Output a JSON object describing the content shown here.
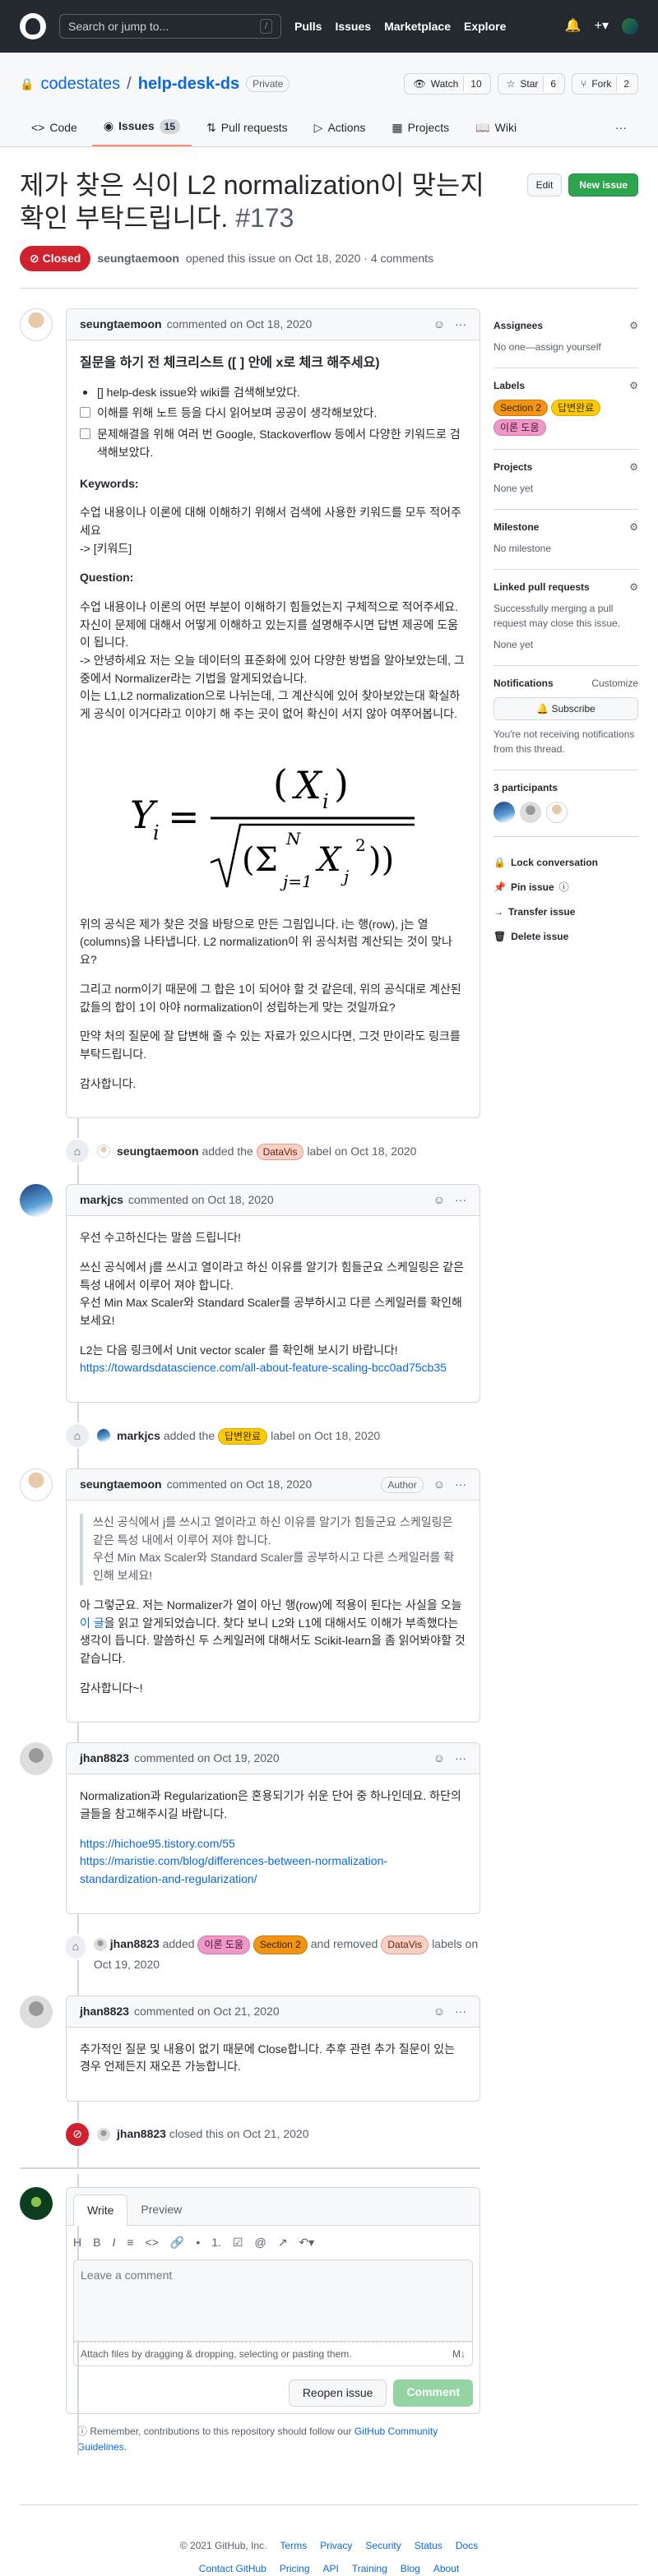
{
  "topbar": {
    "search_placeholder": "Search or jump to...",
    "slash": "/",
    "nav": [
      "Pulls",
      "Issues",
      "Marketplace",
      "Explore"
    ],
    "plus": "+▾",
    "bell": "🔔"
  },
  "repo": {
    "owner": "codestates",
    "separator": "/",
    "name": "help-desk-ds",
    "visibility": "Private",
    "watch_label": "Watch",
    "watch_count": "10",
    "star_label": "Star",
    "star_count": "6",
    "fork_label": "Fork",
    "fork_count": "2",
    "tabs": [
      {
        "label": "Code"
      },
      {
        "label": "Issues",
        "count": "15"
      },
      {
        "label": "Pull requests"
      },
      {
        "label": "Actions"
      },
      {
        "label": "Projects"
      },
      {
        "label": "Wiki"
      }
    ],
    "more": "···"
  },
  "issue": {
    "title": "제가 찾은 식이 L2 normalization이 맞는지 확인 부탁드립니다.",
    "number": "#173",
    "edit_label": "Edit",
    "new_label": "New issue",
    "status": "Closed",
    "author": "seungtaemoon",
    "meta": "opened this issue on Oct 18, 2020 · 4 comments"
  },
  "c1": {
    "author": "seungtaemoon",
    "when": "commented on Oct 18, 2020",
    "h": "질문을 하기 전 체크리스트 ([ ] 안에 x로 체크 해주세요)",
    "li1": "[] help-desk issue와 wiki를 검색해보았다.",
    "li2": "이해를 위해 노트 등을 다시 읽어보며 공공이 생각해보았다.",
    "li3": "문제해결을 위해 여러 번 Google, Stackoverflow 등에서 다양한 키워드로 검색해보았다.",
    "kw_h": "Keywords:",
    "kw": "수업 내용이나 이론에 대해 이해하기 위해서 검색에 사용한 키워드를 모두 적어주세요",
    "kw2": "-> [키워드]",
    "q_h": "Question:",
    "q": "수업 내용이나 이론의 어떤 부분이 이해하기 힘들었는지 구체적으로 적어주세요. 자신이 문제에 대해서 어떻게 이해하고 있는지를 설명해주시면 답변 제공에 도움이 됩니다.",
    "q2": "-> 안녕하세요 저는 오늘 데이터의 표준화에 있어 다양한 방법을 알아보았는데, 그 중에서 Normalizer라는 기법을 알게되었습니다.",
    "q3": "이는 L1,L2 normalization으로 나뉘는데, 그 계산식에 있어 찾아보았는대 확실하게 공식이 이거다라고 이야기 해 주는 곳이 없어 확신이 서지 않아 여쭈어봅니다.",
    "p1": "위의 공식은 제가 찾은 것을 바탕으로 만든 그림입니다. i는 행(row), j는 열(columns)을 나타냅니다. L2 normalization이 위 공식처럼 계산되는 것이 맞나요?",
    "p2": "그리고 norm이기 때문에 그 합은 1이 되어야 할 것 같은데, 위의 공식대로 계산된 값들의 합이 1이 아야 normalization이 성립하는게 맞는 것일까요?",
    "p3": "만약 처의 질문에 잘 답변해 줄 수 있는 자료가 있으시다면, 그것 만이라도 링크를 부탁드립니다.",
    "p4": "감사합니다."
  },
  "ev1": {
    "user": "seungtaemoon",
    "pre": "added the",
    "label": "DataVis",
    "post": "label on Oct 18, 2020"
  },
  "c2": {
    "author": "markjcs",
    "when": "commented on Oct 18, 2020",
    "p1": "우선 수고하신다는 말씀 드립니다!",
    "p2": "쓰신 공식에서 j를 쓰시고 열이라고 하신 이유를 알기가 힘들군요 스케일링은 같은 특성 내에서 이루어 져야 합니다.",
    "p3": "우선 Min Max Scaler와 Standard Scaler를 공부하시고 다른 스케일러를 확인해 보세요!",
    "p4": "L2는 다음 링크에서 Unit vector scaler 를 확인해 보시기 바랍니다!",
    "link": "https://towardsdatascience.com/all-about-feature-scaling-bcc0ad75cb35"
  },
  "ev2": {
    "user": "markjcs",
    "pre": "added the",
    "label": "답변완료",
    "post": "label on Oct 18, 2020"
  },
  "c3": {
    "author": "seungtaemoon",
    "when": "commented on Oct 18, 2020",
    "role": "Author",
    "q1": "쓰신 공식에서 j를 쓰시고 열이라고 하신 이유를 알기가 힘들군요 스케일링은 같은 특성 내에서 이루어 져야 합니다.",
    "q2": "우선 Min Max Scaler와 Standard Scaler를 공부하시고 다른 스케일러를 확인해 보세요!",
    "p1a": "아 그렇군요. 저는 Normalizer가 열이 아닌  행(row)에 적용이 된다는 사실을 오늘",
    "p1link": "이 글",
    "p1b": "을 읽고 알게되었습니다. 찾다 보니 L2와 L1에 대해서도 이해가 부족했다는 생각이 듭니다. 말씀하신 두 스케일러에 대해서도 Scikit-learn을 좀 읽어봐야할 것 같습니다.",
    "p2": "감사합니다~!"
  },
  "c4": {
    "author": "jhan8823",
    "when": "commented on Oct 19, 2020",
    "p1": "Normalization과 Regularization은 혼용되기가 쉬운 단어 중 하나인데요. 하단의 글들을 참고해주시길 바랍니다.",
    "link1": "https://hichoe95.tistory.com/55",
    "link2": "https://maristie.com/blog/differences-between-normalization-standardization-and-regularization/"
  },
  "ev3": {
    "user": "jhan8823",
    "pre": "added",
    "l1": "이론 도움",
    "l2": "Section 2",
    "mid": "and removed",
    "l3": "DataVis",
    "post": "labels on Oct 19, 2020"
  },
  "c5": {
    "author": "jhan8823",
    "when": "commented on Oct 21, 2020",
    "p1": "추가적인 질문 및 내용이 없기 때문에 Close합니다. 추후 관련 추가 질문이 있는 경우 언제든지 재오픈 가능합니다."
  },
  "ev4": {
    "user": "jhan8823",
    "post": "closed this on Oct 21, 2020"
  },
  "editor": {
    "tab_write": "Write",
    "tab_preview": "Preview",
    "placeholder": "Leave a comment",
    "attach": "Attach files by dragging & dropping, selecting or pasting them.",
    "md": "M↓",
    "reopen": "Reopen issue",
    "comment": "Comment",
    "tools": [
      "H",
      "B",
      "I",
      "≡",
      "<>",
      "🔗",
      "•",
      "1.",
      "☑",
      "@",
      "↗",
      "↶▾"
    ]
  },
  "remind": {
    "text": "Remember, contributions to this repository should follow our",
    "link": "GitHub Community Guidelines",
    "end": "."
  },
  "sidebar": {
    "assignees_h": "Assignees",
    "assignees": "No one—assign yourself",
    "labels_h": "Labels",
    "labels": [
      "Section 2",
      "답변완료",
      "이론 도움"
    ],
    "projects_h": "Projects",
    "projects": "None yet",
    "milestone_h": "Milestone",
    "milestone": "No milestone",
    "linked_h": "Linked pull requests",
    "linked": "Successfully merging a pull request may close this issue.",
    "linked2": "None yet",
    "notif_h": "Notifications",
    "customize": "Customize",
    "subscribe": "Subscribe",
    "notif": "You're not receiving notifications from this thread.",
    "part_h": "3 participants",
    "actions": [
      "Lock conversation",
      "Pin issue",
      "Transfer issue",
      "Delete issue"
    ]
  },
  "footer": {
    "copy": "© 2021 GitHub, Inc.",
    "row1": [
      "Terms",
      "Privacy",
      "Security",
      "Status",
      "Docs"
    ],
    "row2": [
      "Contact GitHub",
      "Pricing",
      "API",
      "Training",
      "Blog",
      "About"
    ]
  },
  "colors": {
    "closed": "#cf222e",
    "green": "#2da44e",
    "label_datavis": "#f9d0c4",
    "label_section2": "#f29513",
    "label_answered": "#fbca04",
    "label_theory": "#ee99c8"
  }
}
